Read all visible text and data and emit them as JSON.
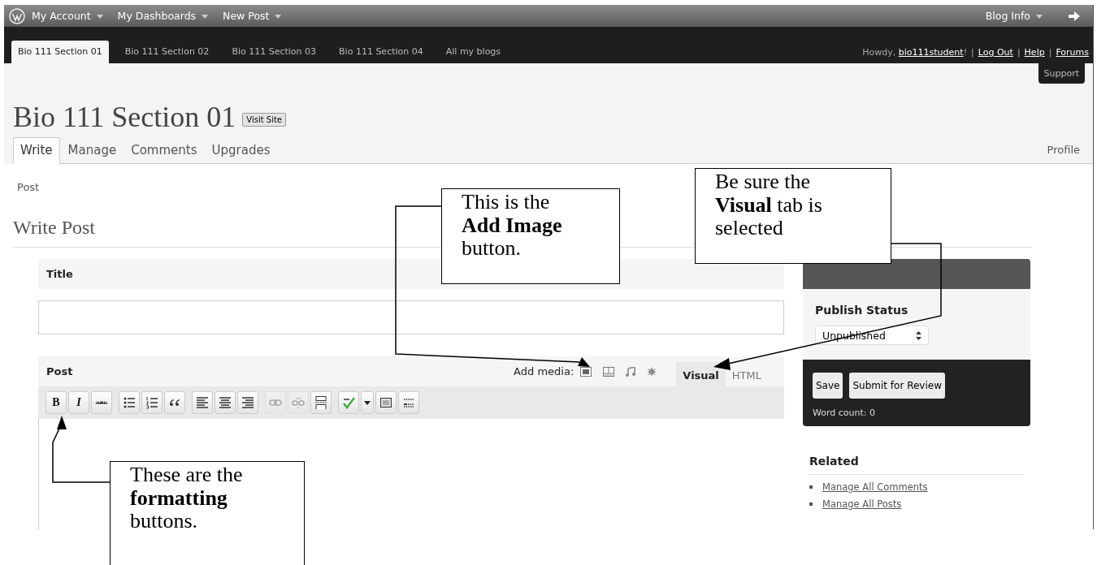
{
  "admin_bar": {
    "menus": [
      "My Account",
      "My Dashboards",
      "New Post"
    ],
    "right_menu": "Blog Info"
  },
  "blog_tabs": [
    {
      "label": "Bio 111 Section 01",
      "selected": true
    },
    {
      "label": "Bio 111 Section 02",
      "selected": false
    },
    {
      "label": "Bio 111 Section 03",
      "selected": false
    },
    {
      "label": "Bio 111 Section 04",
      "selected": false
    },
    {
      "label": "All my blogs",
      "selected": false
    }
  ],
  "user": {
    "greeting": "Howdy,",
    "username": "bio111student",
    "suffix": "!",
    "separator": "|",
    "links": [
      "Log Out",
      "Help",
      "Forums"
    ],
    "tooltip": "Support"
  },
  "site": {
    "title": "Bio 111 Section 01",
    "visit_button": "Visit Site"
  },
  "menu_tabs": [
    {
      "label": "Write",
      "selected": true
    },
    {
      "label": "Manage",
      "selected": false
    },
    {
      "label": "Comments",
      "selected": false
    },
    {
      "label": "Upgrades",
      "selected": false
    }
  ],
  "profile_link": "Profile",
  "submenu": [
    "Post"
  ],
  "page_title": "Write Post",
  "title_box": {
    "heading": "Title"
  },
  "post_box": {
    "heading": "Post",
    "add_media_label": "Add media:",
    "media_buttons": [
      {
        "kind": "image"
      },
      {
        "kind": "video"
      },
      {
        "kind": "audio"
      },
      {
        "kind": "media"
      }
    ],
    "editor_tabs": [
      {
        "label": "Visual",
        "selected": true
      },
      {
        "label": "HTML",
        "selected": false
      }
    ],
    "toolbar": [
      [
        {
          "kind": "bold",
          "label": "B",
          "disabled": false
        },
        {
          "kind": "italic",
          "label": "I",
          "disabled": false
        },
        {
          "kind": "strike",
          "label": "ABC",
          "disabled": false
        }
      ],
      [
        {
          "kind": "bullets",
          "disabled": false
        },
        {
          "kind": "numbers",
          "disabled": false
        },
        {
          "kind": "quote",
          "disabled": false
        }
      ],
      [
        {
          "kind": "align-left",
          "disabled": false
        },
        {
          "kind": "align-center",
          "disabled": false
        },
        {
          "kind": "align-right",
          "disabled": false
        }
      ],
      [
        {
          "kind": "link",
          "disabled": true
        },
        {
          "kind": "unlink",
          "disabled": true
        },
        {
          "kind": "more",
          "disabled": false
        }
      ],
      [
        {
          "kind": "spellcheck",
          "disabled": false
        },
        {
          "kind": "dropdown",
          "disabled": false
        },
        {
          "kind": "fullscreen",
          "disabled": false
        },
        {
          "kind": "kitchen-sink",
          "disabled": false
        }
      ]
    ]
  },
  "sidebar": {
    "publish_heading": "Publish Status",
    "status_value": "Unpublished",
    "buttons": [
      "Save",
      "Submit for Review"
    ],
    "word_count": "Word count: 0",
    "related_heading": "Related",
    "related_links": [
      "Manage All Comments",
      "Manage All Posts"
    ]
  },
  "callouts": [
    "This is the **Add Image** button.",
    "Be sure the **Visual** tab is selected",
    "These are the **formatting** buttons."
  ]
}
